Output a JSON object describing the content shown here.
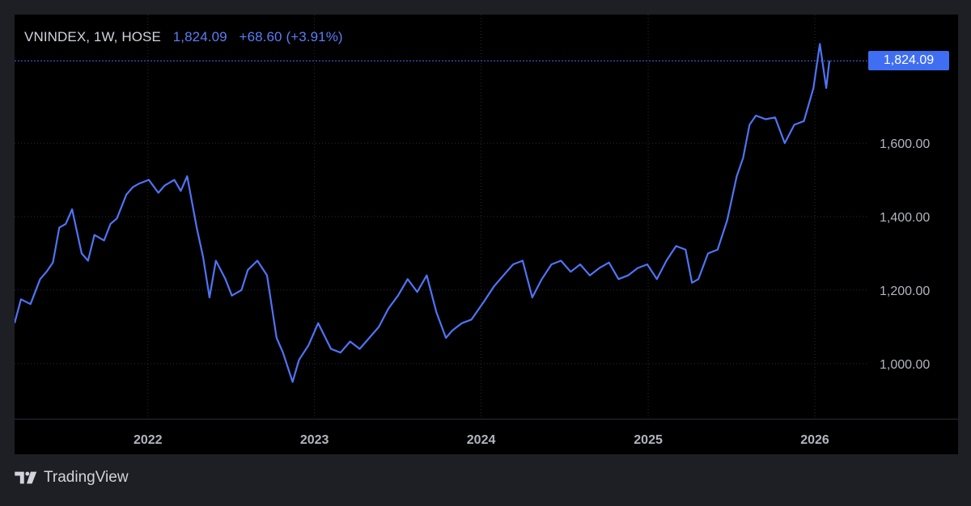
{
  "legend": {
    "symbol": "VNINDEX, 1W, HOSE",
    "close": "1,824.09",
    "change": "+68.60 (+3.91%)"
  },
  "last_price_label": "1,824.09",
  "footer": {
    "brand": "TradingView",
    "logo_icon": "tradingview-logo-icon"
  },
  "colors": {
    "line": "#4f74f5",
    "price_tag": "#3f6ef3",
    "axis_text": "#b2b5be",
    "grid": "#2a2e39",
    "background": "#000000",
    "frame": "#1e1f24"
  },
  "chart_data": {
    "type": "line",
    "title": "",
    "xlabel": "",
    "ylabel": "",
    "ylim": [
      850,
      1950
    ],
    "xlim": [
      "2021-03-15",
      "2026-04-28"
    ],
    "y_ticks": [
      1000,
      1200,
      1400,
      1600
    ],
    "y_tick_labels": [
      "1,000.00",
      "1,200.00",
      "1,400.00",
      "1,600.00"
    ],
    "x_ticks": [
      "2022-01-01",
      "2023-01-01",
      "2024-01-01",
      "2025-01-01",
      "2026-01-01"
    ],
    "x_tick_labels": [
      "2022",
      "2023",
      "2024",
      "2025",
      "2026"
    ],
    "grid": true,
    "last_value": 1824.09,
    "series": [
      {
        "color": "#4f74f5",
        "x": [
          "2021-03-15",
          "2021-03-29",
          "2021-04-19",
          "2021-05-10",
          "2021-05-24",
          "2021-06-07",
          "2021-06-21",
          "2021-07-05",
          "2021-07-19",
          "2021-08-09",
          "2021-08-23",
          "2021-09-06",
          "2021-09-27",
          "2021-10-11",
          "2021-10-25",
          "2021-11-15",
          "2021-11-29",
          "2021-12-13",
          "2022-01-03",
          "2022-01-24",
          "2022-02-07",
          "2022-02-28",
          "2022-03-14",
          "2022-03-28",
          "2022-04-18",
          "2022-05-02",
          "2022-05-16",
          "2022-05-30",
          "2022-06-20",
          "2022-07-04",
          "2022-07-25",
          "2022-08-08",
          "2022-08-29",
          "2022-09-19",
          "2022-10-10",
          "2022-10-24",
          "2022-11-14",
          "2022-11-28",
          "2022-12-19",
          "2023-01-09",
          "2023-02-06",
          "2023-02-27",
          "2023-03-20",
          "2023-04-10",
          "2023-05-01",
          "2023-05-22",
          "2023-06-12",
          "2023-07-03",
          "2023-07-24",
          "2023-08-14",
          "2023-09-04",
          "2023-09-25",
          "2023-10-16",
          "2023-10-30",
          "2023-11-20",
          "2023-12-11",
          "2024-01-08",
          "2024-01-29",
          "2024-02-19",
          "2024-03-11",
          "2024-04-01",
          "2024-04-22",
          "2024-05-13",
          "2024-06-03",
          "2024-06-24",
          "2024-07-15",
          "2024-08-05",
          "2024-08-26",
          "2024-09-16",
          "2024-10-07",
          "2024-10-28",
          "2024-11-18",
          "2024-12-09",
          "2024-12-30",
          "2025-01-20",
          "2025-02-10",
          "2025-03-03",
          "2025-03-24",
          "2025-04-07",
          "2025-04-21",
          "2025-05-12",
          "2025-06-02",
          "2025-06-23",
          "2025-07-14",
          "2025-07-28",
          "2025-08-11",
          "2025-08-25",
          "2025-09-15",
          "2025-10-06",
          "2025-10-27",
          "2025-11-17",
          "2025-12-08",
          "2025-12-29",
          "2026-01-12",
          "2026-01-26",
          "2026-02-02"
        ],
        "values": [
          1110,
          1175,
          1162,
          1230,
          1250,
          1275,
          1370,
          1380,
          1420,
          1300,
          1280,
          1350,
          1335,
          1380,
          1395,
          1460,
          1480,
          1490,
          1500,
          1465,
          1485,
          1500,
          1470,
          1510,
          1370,
          1290,
          1180,
          1280,
          1230,
          1185,
          1200,
          1255,
          1280,
          1240,
          1070,
          1030,
          950,
          1010,
          1050,
          1110,
          1040,
          1030,
          1060,
          1040,
          1070,
          1100,
          1150,
          1185,
          1230,
          1195,
          1240,
          1140,
          1070,
          1090,
          1110,
          1120,
          1170,
          1210,
          1240,
          1270,
          1280,
          1180,
          1230,
          1270,
          1280,
          1250,
          1270,
          1240,
          1260,
          1275,
          1230,
          1240,
          1260,
          1270,
          1230,
          1280,
          1320,
          1310,
          1220,
          1230,
          1300,
          1310,
          1390,
          1510,
          1560,
          1650,
          1675,
          1665,
          1670,
          1600,
          1650,
          1660,
          1750,
          1870,
          1750,
          1824
        ]
      }
    ]
  }
}
